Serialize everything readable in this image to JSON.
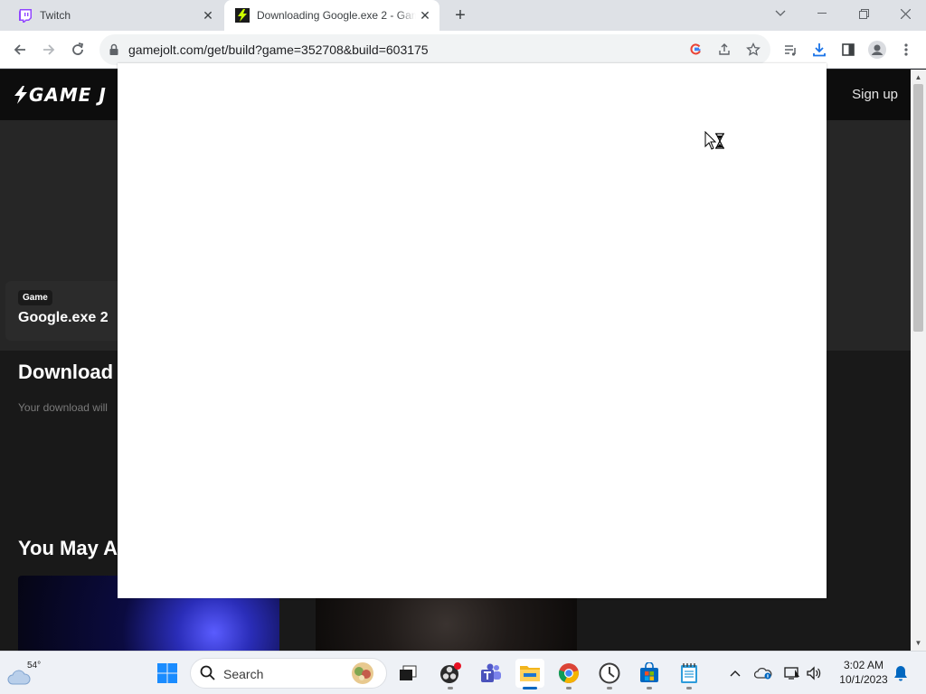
{
  "browser": {
    "tabs": [
      {
        "title": "Twitch",
        "active": false,
        "favicon": "twitch-icon"
      },
      {
        "title": "Downloading Google.exe 2 - Game Jolt",
        "active": true,
        "favicon": "gamejolt-icon"
      }
    ],
    "address": "gamejolt.com/get/build?game=352708&build=603175"
  },
  "page": {
    "header": {
      "logo": "GAME J",
      "signup": "Sign up"
    },
    "game_card": {
      "tag": "Game",
      "title": "Google.exe 2"
    },
    "download_heading": "Download",
    "download_sub": "Your download will",
    "may_heading": "You May A"
  },
  "taskbar": {
    "weather_temp": "54°",
    "search_label": "Search",
    "clock_time": "3:02 AM",
    "clock_date": "10/1/2023"
  },
  "colors": {
    "twitch": "#9146ff",
    "gamejolt_green": "#ccff00",
    "page_bg": "#191919",
    "windows_blue": "#0067c0"
  }
}
